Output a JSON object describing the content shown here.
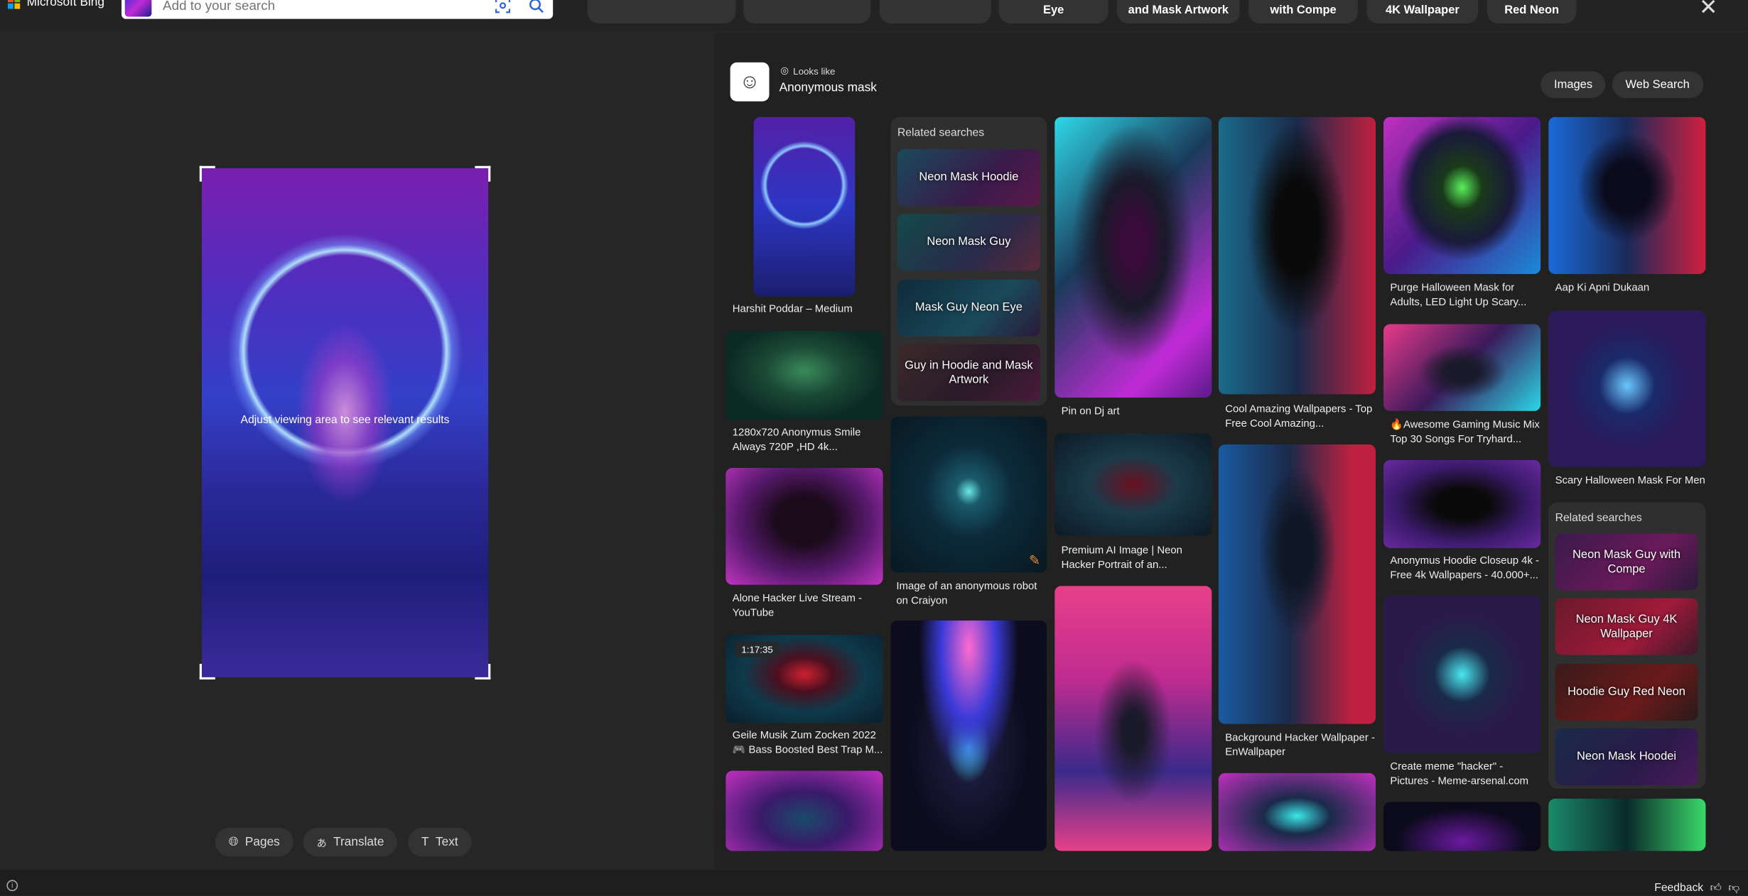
{
  "brand": {
    "name": "Microsoft Bing",
    "colors": [
      "#f25022",
      "#7fba00",
      "#00a4ef",
      "#ffb900"
    ]
  },
  "search": {
    "placeholder": "Add to your search",
    "visual_icon": "visual-search-icon",
    "search_icon": "search-icon"
  },
  "top_pills": [
    "",
    "",
    "",
    "Eye",
    "and Mask Artwork",
    "with Compe",
    "4K Wallpaper",
    "Red Neon"
  ],
  "preview": {
    "hint": "Adjust viewing area to see relevant results"
  },
  "bottom_buttons": [
    {
      "label": "Pages",
      "icon": "globe-icon"
    },
    {
      "label": "Translate",
      "icon": "translate-icon"
    },
    {
      "label": "Text",
      "icon": "text-icon"
    }
  ],
  "results_header": {
    "looks_like": "Looks like",
    "entity": "Anonymous mask",
    "buttons": [
      "Images",
      "Web Search"
    ]
  },
  "results": {
    "col1": [
      {
        "caption": "Harshit Poddar – Medium"
      },
      {
        "caption": "1280x720 Anonymus Smile Always 720P ,HD 4k..."
      },
      {
        "caption": "Alone Hacker Live Stream - YouTube"
      },
      {
        "caption": "Geile Musik Zum Zocken 2022 🎮 Bass Boosted Best Trap M...",
        "badge": "1:17:35"
      }
    ],
    "col2_related": {
      "title": "Related searches",
      "items": [
        "Neon Mask Hoodie",
        "Neon Mask Guy",
        "Mask Guy Neon Eye",
        "Guy in Hoodie and Mask Artwork"
      ]
    },
    "col2": [
      {
        "caption": "Image of an anonymous robot on Craiyon"
      }
    ],
    "col3": [
      {
        "caption": "Pin on Dj art"
      },
      {
        "caption": "Premium AI Image | Neon Hacker Portrait of an..."
      }
    ],
    "col4": [
      {
        "caption": "Cool Amazing Wallpapers - Top Free Cool Amazing..."
      },
      {
        "caption": "Background Hacker Wallpaper - EnWallpaper"
      }
    ],
    "col5": [
      {
        "caption": "Purge Halloween Mask for Adults, LED Light Up Scary..."
      },
      {
        "caption": "🔥Awesome Gaming Music Mix Top 30 Songs For Tryhard..."
      },
      {
        "caption": "Anonymus Hoodie Closeup 4k - Free 4k Wallpapers - 40.000+..."
      },
      {
        "caption": "Create meme \"hacker\" - Pictures - Meme-arsenal.com"
      }
    ],
    "col6": [
      {
        "caption": "Aap Ki Apni Dukaan"
      },
      {
        "caption": "Scary Halloween Mask For Men"
      }
    ],
    "col6_related": {
      "title": "Related searches",
      "items": [
        "Neon Mask Guy with Compe",
        "Neon Mask Guy 4K Wallpaper",
        "Hoodie Guy Red Neon",
        "Neon Mask Hoodei"
      ]
    }
  },
  "footer": {
    "feedback": "Feedback",
    "info_icon": "info-icon"
  }
}
